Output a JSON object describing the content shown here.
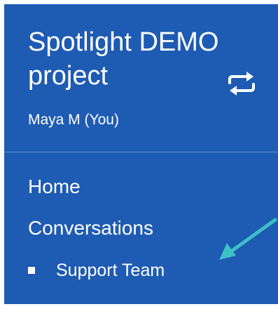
{
  "project": {
    "title": "Spotlight DEMO project",
    "user": "Maya M (You)"
  },
  "nav": {
    "home": "Home",
    "conversations": "Conversations",
    "sub_items": [
      "Support Team"
    ]
  },
  "icons": {
    "switch": "swap-arrows-icon",
    "annotation": "pointer-arrow-icon",
    "bullet": "square-bullet-icon"
  },
  "colors": {
    "sidebar_bg": "#1e5bb3",
    "text": "#ffffff",
    "annotation_arrow": "#3dbfc6"
  }
}
